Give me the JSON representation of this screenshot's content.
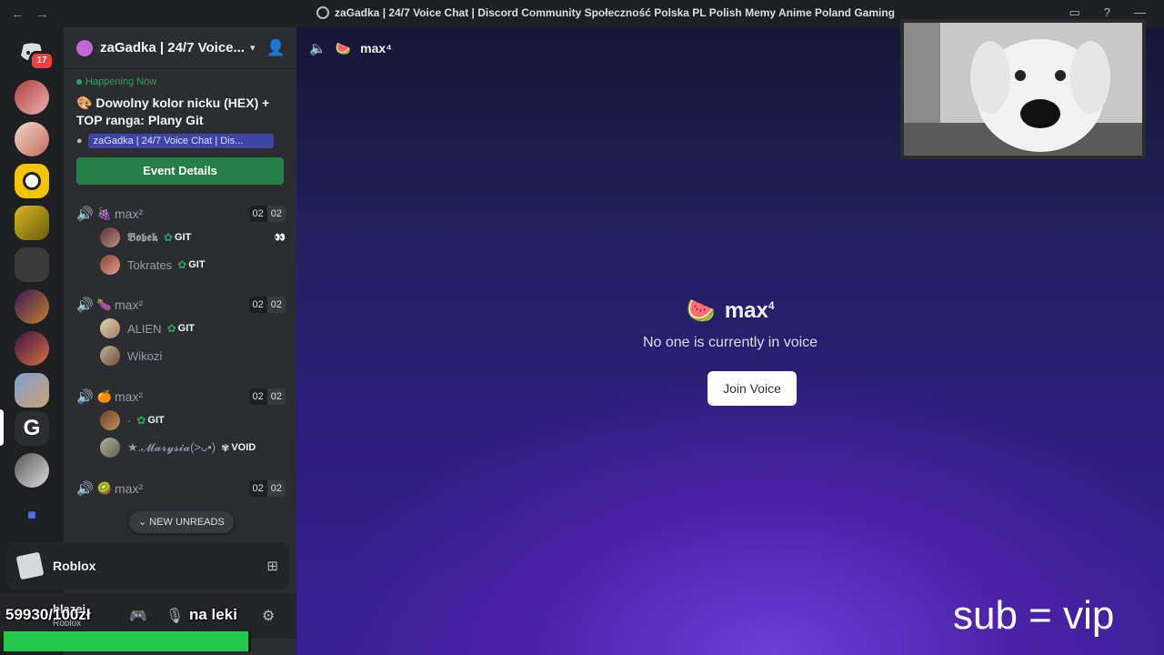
{
  "titlebar": {
    "title": "zaGadka | 24/7 Voice Chat | Discord Community Społeczność Polska PL Polish Memy Anime Poland Gaming"
  },
  "server_rail": {
    "notification_count": "17"
  },
  "guild": {
    "name": "zaGadka | 24/7 Voice..."
  },
  "event": {
    "status": "Happening Now",
    "title": "Dowolny kolor nicku (HEX) + TOP ranga: Plany Git",
    "location": "zaGadka | 24/7 Voice Chat | Dis...",
    "button_label": "Event Details"
  },
  "voice_channels": [
    {
      "emoji": "🍇",
      "name": "max²",
      "count_a": "02",
      "count_b": "02",
      "members": [
        {
          "name": "𝕭𝖔𝖇𝖊𝖐",
          "tag": "GIT",
          "extra": "👀"
        },
        {
          "name": "Tokrates",
          "tag": "GIT"
        }
      ]
    },
    {
      "emoji": "🍆",
      "name": "max²",
      "count_a": "02",
      "count_b": "02",
      "members": [
        {
          "name": "ALIEN",
          "tag": "GIT"
        },
        {
          "name": "Wikozi",
          "tag": ""
        }
      ]
    },
    {
      "emoji": "🍊",
      "name": "max²",
      "count_a": "02",
      "count_b": "02",
      "members": [
        {
          "name": "·",
          "tag": "GIT"
        },
        {
          "name": "★.𝓜𝓪𝓻𝔂𝓼𝓲𝓪(>ᴗ•)",
          "tag": "VOID"
        }
      ]
    },
    {
      "emoji": "🥝",
      "name": "max²",
      "count_a": "02",
      "count_b": "02",
      "members": []
    }
  ],
  "new_unreads_label": "NEW UNREADS",
  "activity": {
    "name": "Roblox"
  },
  "user_panel": {
    "username": "blazej",
    "status": "Roblox"
  },
  "overlay": {
    "counter": "59930/100zł",
    "leki": "na leki",
    "sub_vip": "sub = vip",
    "progress_fraction": 0.99
  },
  "stage": {
    "header_name": "max⁴",
    "channel_name": "max",
    "channel_sup": "4",
    "status": "No one is currently in voice",
    "join_label": "Join Voice"
  },
  "colors": {
    "green": "#23a55a",
    "blurple_location": "#3e45a6",
    "progress": "#22c84a"
  }
}
